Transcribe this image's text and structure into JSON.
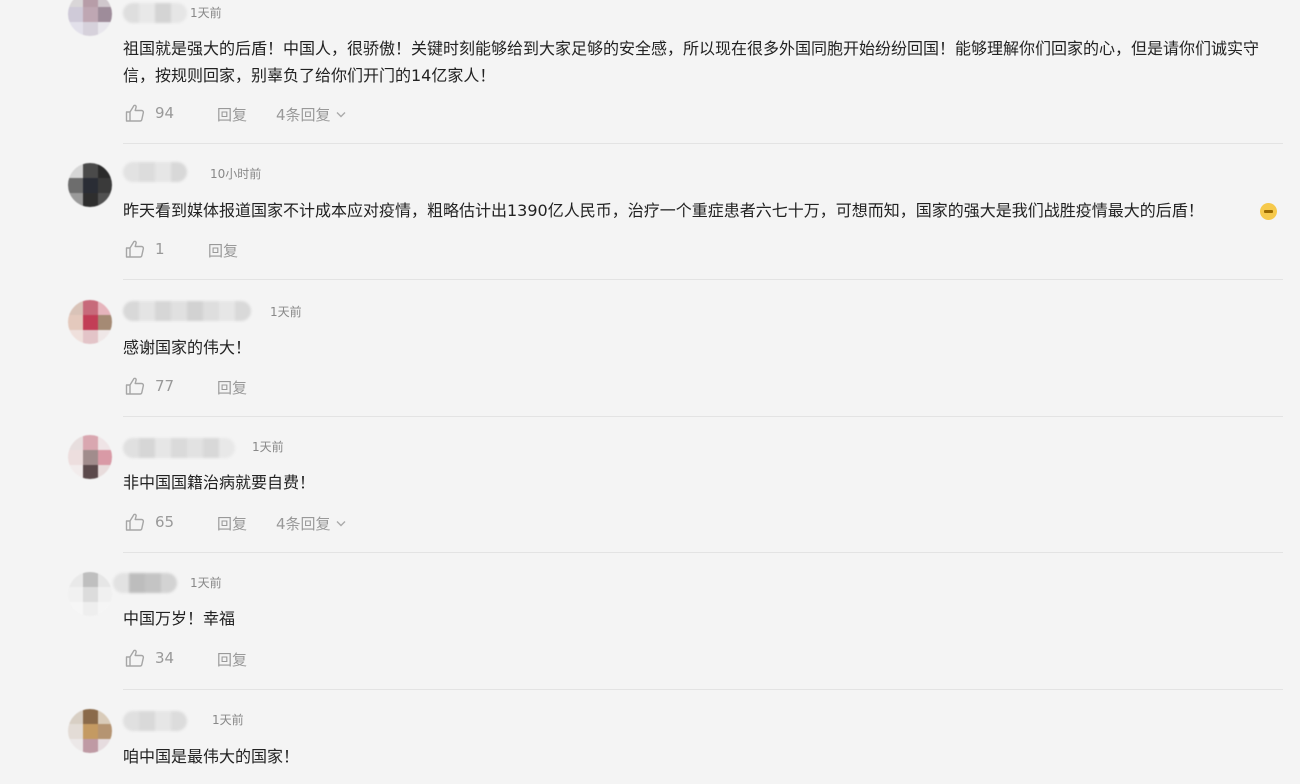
{
  "labels": {
    "reply": "回复"
  },
  "comments": [
    {
      "time": "1天前",
      "text": "祖国就是强大的后盾！中国人，很骄傲！关键时刻能够给到大家足够的安全感，所以现在很多外国同胞开始纷纷回国！能够理解你们回家的心，但是请你们诚实守信，按规则回家，别辜负了给你们开门的14亿家人！",
      "likes": "94",
      "replies": "4条回复"
    },
    {
      "time": "10小时前",
      "text": "昨天看到媒体报道国家不计成本应对疫情，粗略估计出1390亿人民币，治疗一个重症患者六七十万，可想而知，国家的强大是我们战胜疫情最大的后盾！",
      "likes": "1",
      "replies": ""
    },
    {
      "time": "1天前",
      "text": "感谢国家的伟大！",
      "likes": "77",
      "replies": ""
    },
    {
      "time": "1天前",
      "text": "非中国国籍治病就要自费！",
      "likes": "65",
      "replies": "4条回复"
    },
    {
      "time": "1天前",
      "text": "中国万岁！幸福",
      "likes": "34",
      "replies": ""
    },
    {
      "time": "1天前",
      "text": "咱中国是最伟大的国家！",
      "likes": "",
      "replies": ""
    }
  ]
}
